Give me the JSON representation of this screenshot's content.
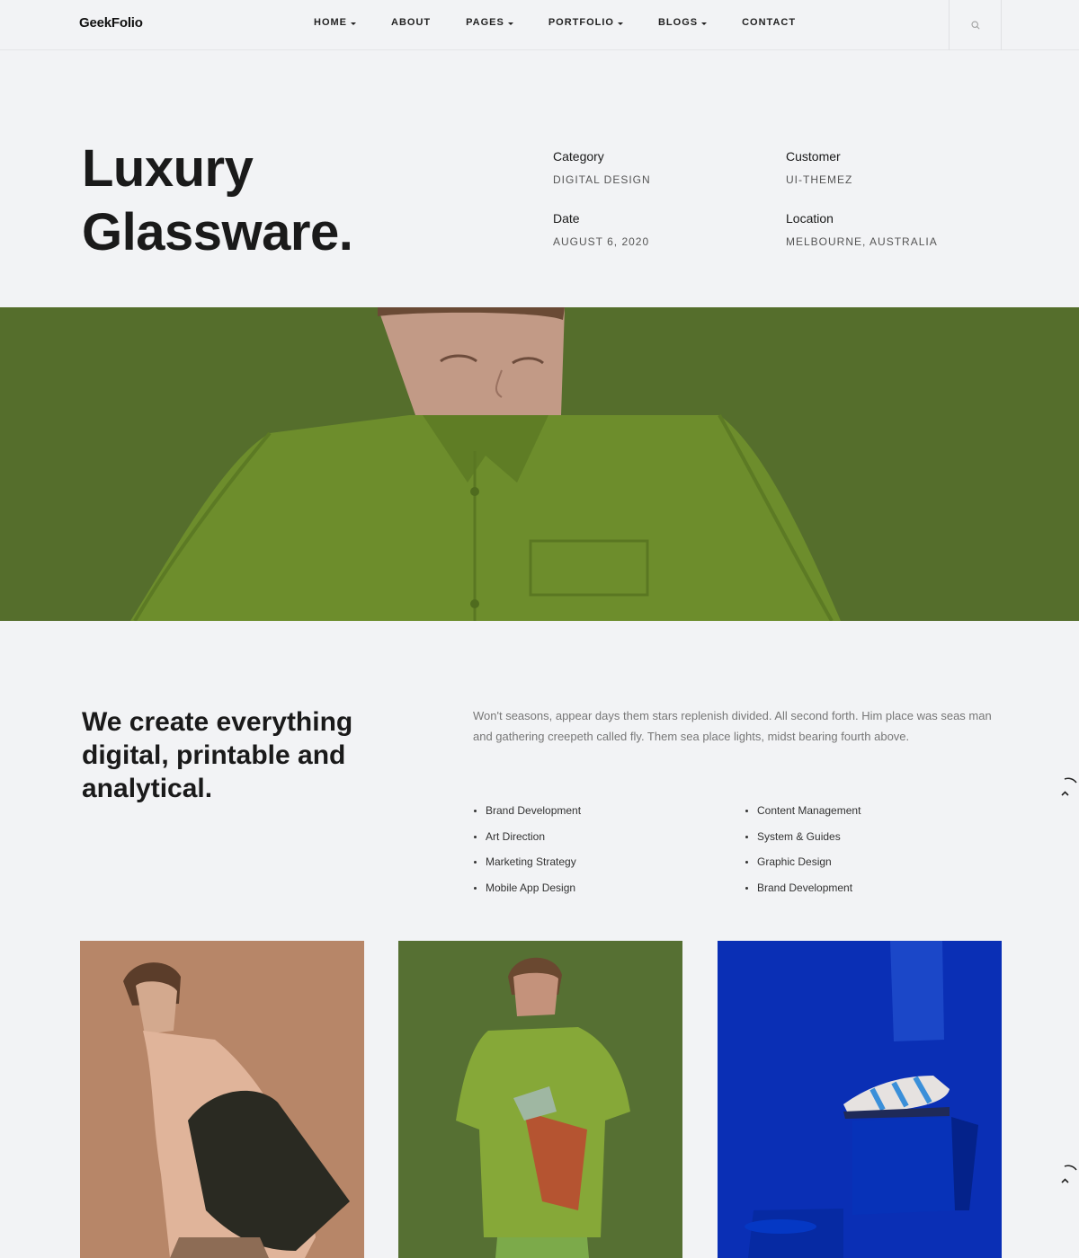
{
  "brand": {
    "name": "GeekFolio"
  },
  "nav": {
    "items": [
      {
        "label": "HOME",
        "dropdown": true
      },
      {
        "label": "ABOUT",
        "dropdown": false
      },
      {
        "label": "PAGES",
        "dropdown": true
      },
      {
        "label": "PORTFOLIO",
        "dropdown": true
      },
      {
        "label": "BLOGS",
        "dropdown": true
      },
      {
        "label": "CONTACT",
        "dropdown": false
      }
    ],
    "search_icon": "search-icon"
  },
  "hero": {
    "title_line1": "Luxury",
    "title_line2": "Glassware.",
    "meta": {
      "category": {
        "label": "Category",
        "value": "DIGITAL DESIGN"
      },
      "customer": {
        "label": "Customer",
        "value": "UI-THEMEZ"
      },
      "date": {
        "label": "Date",
        "value": "AUGUST 6, 2020"
      },
      "location": {
        "label": "Location",
        "value": "MELBOURNE, AUSTRALIA"
      }
    }
  },
  "about": {
    "heading": "We create everything digital, printable and analytical.",
    "text": "Won't seasons, appear days them stars replenish divided. All second forth. Him place was seas man and gathering creepeth called fly. Them sea place lights, midst bearing fourth above.",
    "services_left": [
      "Brand Development",
      "Art Direction",
      "Marketing Strategy",
      "Mobile App Design"
    ],
    "services_right": [
      "Content Management",
      "System & Guides",
      "Graphic Design",
      "Brand Development"
    ]
  },
  "colors": {
    "background": "#f2f3f5",
    "banner_green": "#556e2c",
    "card_tan": "#b78668",
    "card_green": "#567033",
    "card_blue": "#0a2fb5"
  }
}
